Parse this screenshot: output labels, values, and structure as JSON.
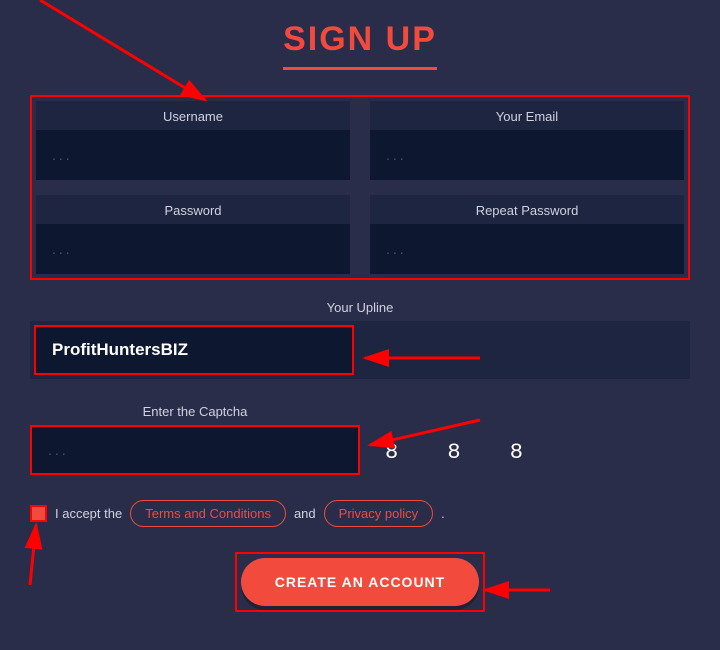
{
  "title": "SIGN UP",
  "fields": {
    "username": {
      "label": "Username",
      "placeholder": "...",
      "value": ""
    },
    "email": {
      "label": "Your Email",
      "placeholder": "...",
      "value": ""
    },
    "password": {
      "label": "Password",
      "placeholder": "...",
      "value": ""
    },
    "repeat_password": {
      "label": "Repeat Password",
      "placeholder": "...",
      "value": ""
    }
  },
  "upline": {
    "label": "Your Upline",
    "value": "ProfitHuntersBIZ"
  },
  "captcha": {
    "label": "Enter the Captcha",
    "placeholder": "...",
    "value": "",
    "code": "8 8 8"
  },
  "terms": {
    "prefix": "I accept the",
    "terms_link": "Terms and Conditions",
    "and": "and",
    "privacy_link": "Privacy policy",
    "suffix": "."
  },
  "submit": "CREATE AN ACCOUNT",
  "annotation_color": "#ff0000"
}
